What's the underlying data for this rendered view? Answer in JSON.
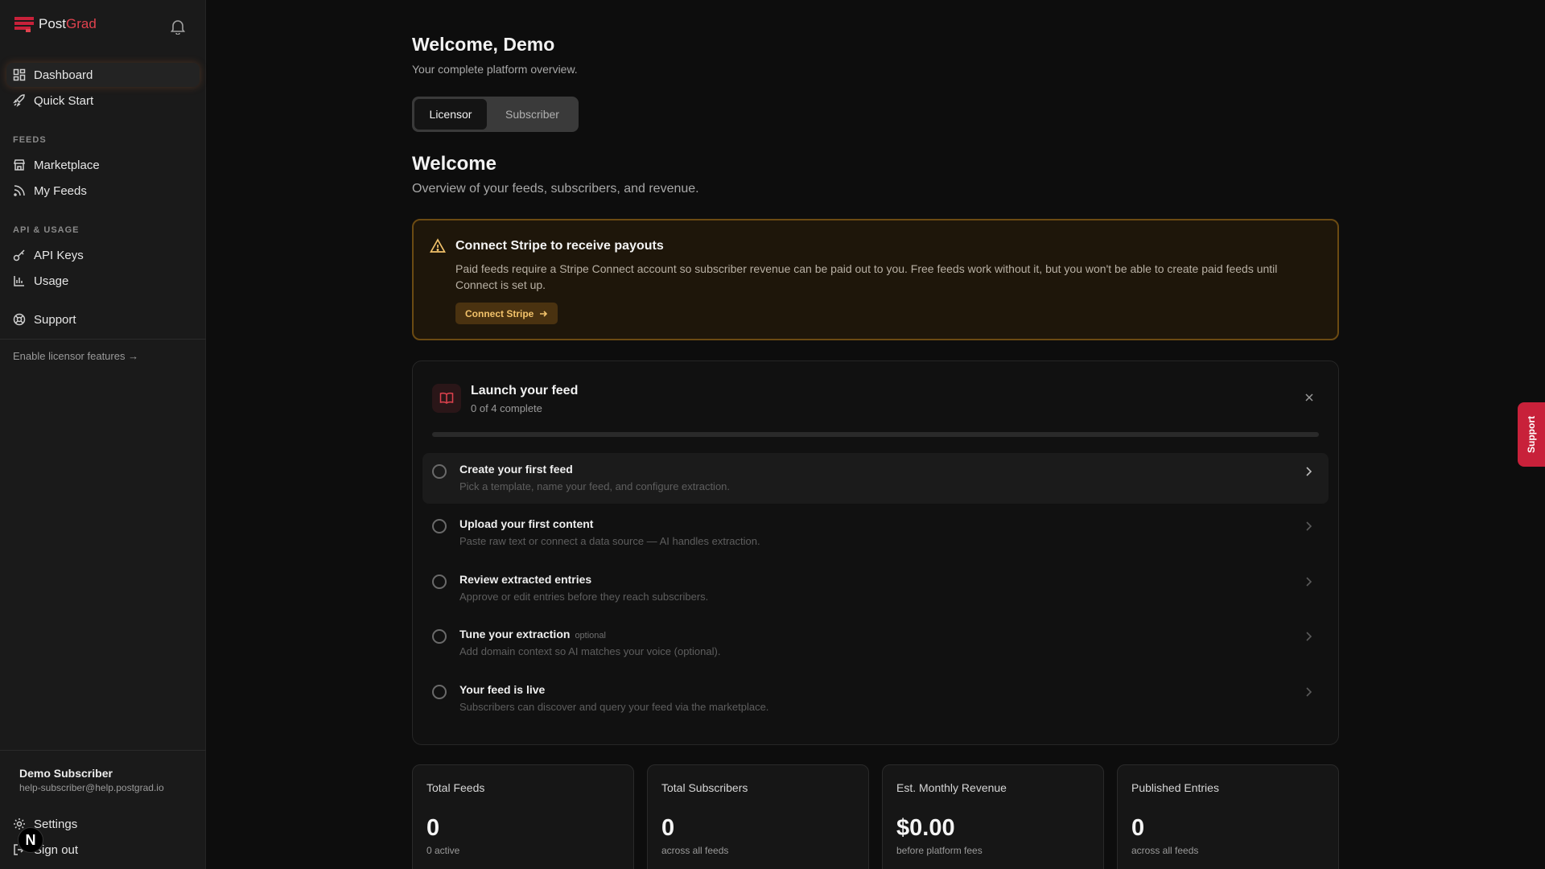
{
  "brand": {
    "name_a": "Post",
    "name_b": "Grad"
  },
  "sidebar": {
    "items": [
      {
        "label": "Dashboard",
        "icon": "dashboard-icon"
      },
      {
        "label": "Quick Start",
        "icon": "rocket-icon"
      },
      {
        "label": "Marketplace",
        "icon": "store-icon"
      },
      {
        "label": "My Feeds",
        "icon": "rss-icon"
      },
      {
        "label": "API Keys",
        "icon": "key-icon"
      },
      {
        "label": "Usage",
        "icon": "chart-icon"
      },
      {
        "label": "Support",
        "icon": "lifebuoy-icon"
      }
    ],
    "sections": {
      "feeds": "FEEDS",
      "api": "API & USAGE"
    },
    "enable_link": "Enable licensor features →",
    "user": {
      "name": "Demo Subscriber",
      "email": "help-subscriber@help.postgrad.io",
      "avatar_letter": "N"
    },
    "settings": "Settings",
    "signout": "Sign out"
  },
  "header": {
    "title": "Welcome, Demo",
    "subtitle": "Your complete platform overview.",
    "toggle": {
      "licensor": "Licensor",
      "subscriber": "Subscriber",
      "selected": "Licensor"
    }
  },
  "welcome": {
    "title": "Welcome",
    "subtitle": "Overview of your feeds, subscribers, and revenue."
  },
  "alert": {
    "title": "Connect Stripe to receive payouts",
    "body": "Paid feeds require a Stripe Connect account so subscriber revenue can be paid out to you. Free feeds work without it, but you won't be able to create paid feeds until Connect is set up.",
    "button": "Connect Stripe"
  },
  "launch": {
    "title": "Launch your feed",
    "count": "0 of 4 complete",
    "progress": 0,
    "tasks": [
      {
        "title": "Create your first feed",
        "desc": "Pick a template, name your feed, and configure extraction.",
        "optional": ""
      },
      {
        "title": "Upload your first content",
        "desc": "Paste raw text or connect a data source — AI handles extraction.",
        "optional": ""
      },
      {
        "title": "Review extracted entries",
        "desc": "Approve or edit entries before they reach subscribers.",
        "optional": ""
      },
      {
        "title": "Tune your extraction",
        "desc": "Add domain context so AI matches your voice (optional).",
        "optional": "optional"
      },
      {
        "title": "Your feed is live",
        "desc": "Subscribers can discover and query your feed via the marketplace.",
        "optional": ""
      }
    ]
  },
  "stats": [
    {
      "label": "Total Feeds",
      "value": "0",
      "sub": "0 active"
    },
    {
      "label": "Total Subscribers",
      "value": "0",
      "sub": "across all feeds"
    },
    {
      "label": "Est. Monthly Revenue",
      "value": "$0.00",
      "sub": "before platform fees"
    },
    {
      "label": "Published Entries",
      "value": "0",
      "sub": "across all feeds"
    }
  ],
  "support_tab": "Support",
  "colors": {
    "accent": "#e0424e",
    "warning": "#f2c26a"
  }
}
